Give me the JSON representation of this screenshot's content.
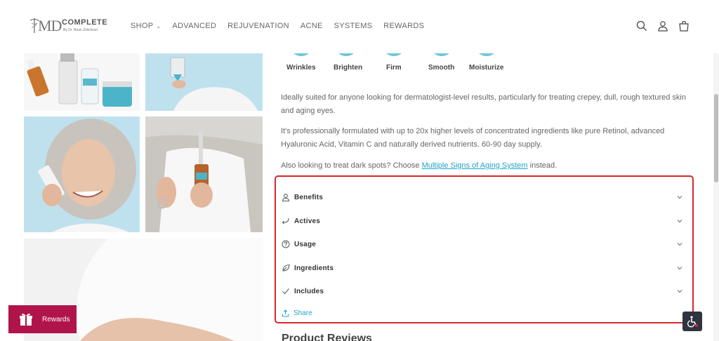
{
  "header": {
    "logo": {
      "md": "MD",
      "brand": "COMPLETE",
      "tagline": "By Dr. Brian Zelickson"
    },
    "nav": [
      {
        "label": "SHOP",
        "has_dropdown": true
      },
      {
        "label": "ADVANCED"
      },
      {
        "label": "REJUVENATION"
      },
      {
        "label": "ACNE"
      },
      {
        "label": "SYSTEMS"
      },
      {
        "label": "REWARDS"
      }
    ],
    "icons": [
      "search-icon",
      "account-icon",
      "cart-icon"
    ]
  },
  "product": {
    "attributes": [
      "Wrinkles",
      "Brighten",
      "Firm",
      "Smooth",
      "Moisturize"
    ],
    "description_1": "Ideally suited for anyone looking for dermatologist-level results, particularly for treating crepey, dull, rough textured skin and aging eyes.",
    "description_2": "It's professionally formulated with up to 20x higher levels of concentrated ingredients like pure Retinol, advanced Hyaluronic Acid, Vitamin C and naturally derived nutrients. 60-90 day supply.",
    "description_3_pre": "Also looking to treat dark spots? Choose ",
    "description_3_link": "Multiple Signs of Aging System",
    "description_3_post": " instead."
  },
  "accordion": [
    {
      "label": "Benefits",
      "icon": "person-icon"
    },
    {
      "label": "Actives",
      "icon": "return-arrow-icon"
    },
    {
      "label": "Usage",
      "icon": "question-circle-icon"
    },
    {
      "label": "Ingredients",
      "icon": "leaf-icon"
    },
    {
      "label": "Includes",
      "icon": "checkmark-icon"
    }
  ],
  "share_label": "Share",
  "reviews_title": "Product Reviews",
  "rewards_label": "Rewards",
  "colors": {
    "accent_link": "#1fa4c4",
    "rewards_bg": "#b0144a",
    "highlight_border": "#d9262c",
    "attribute_circle": "#6fc6db"
  }
}
